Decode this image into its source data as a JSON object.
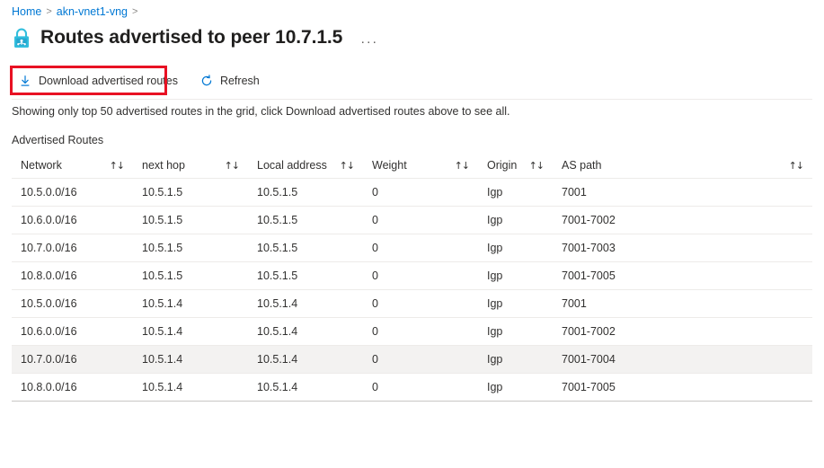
{
  "breadcrumb": {
    "items": [
      {
        "label": "Home"
      },
      {
        "label": "akn-vnet1-vng"
      }
    ],
    "separator": ">"
  },
  "header": {
    "icon": "vpn-gateway-lock-icon",
    "title": "Routes advertised to peer 10.7.1.5",
    "more_options": "···"
  },
  "command_bar": {
    "buttons": [
      {
        "label": "Download advertised routes",
        "icon": "download-icon",
        "highlighted": true
      },
      {
        "label": "Refresh",
        "icon": "refresh-icon",
        "highlighted": false
      }
    ]
  },
  "annotation": {
    "color": "#e81123",
    "target": "Download advertised routes"
  },
  "info_text": "Showing only top 50 advertised routes in the grid, click Download advertised routes above to see all.",
  "section_label": "Advertised Routes",
  "table": {
    "sort_glyph": "↑↓",
    "columns": [
      {
        "key": "network",
        "label": "Network"
      },
      {
        "key": "next_hop",
        "label": "next hop"
      },
      {
        "key": "local_address",
        "label": "Local address"
      },
      {
        "key": "weight",
        "label": "Weight"
      },
      {
        "key": "origin",
        "label": "Origin"
      },
      {
        "key": "as_path",
        "label": "AS path"
      },
      {
        "key": "spacer",
        "label": ""
      }
    ],
    "rows": [
      {
        "network": "10.5.0.0/16",
        "next_hop": "10.5.1.5",
        "local_address": "10.5.1.5",
        "weight": "0",
        "origin": "Igp",
        "as_path": "7001",
        "spacer": "",
        "hover": false
      },
      {
        "network": "10.6.0.0/16",
        "next_hop": "10.5.1.5",
        "local_address": "10.5.1.5",
        "weight": "0",
        "origin": "Igp",
        "as_path": "7001-7002",
        "spacer": "",
        "hover": false
      },
      {
        "network": "10.7.0.0/16",
        "next_hop": "10.5.1.5",
        "local_address": "10.5.1.5",
        "weight": "0",
        "origin": "Igp",
        "as_path": "7001-7003",
        "spacer": "",
        "hover": false
      },
      {
        "network": "10.8.0.0/16",
        "next_hop": "10.5.1.5",
        "local_address": "10.5.1.5",
        "weight": "0",
        "origin": "Igp",
        "as_path": "7001-7005",
        "spacer": "",
        "hover": false
      },
      {
        "network": "10.5.0.0/16",
        "next_hop": "10.5.1.4",
        "local_address": "10.5.1.4",
        "weight": "0",
        "origin": "Igp",
        "as_path": "7001",
        "spacer": "",
        "hover": false
      },
      {
        "network": "10.6.0.0/16",
        "next_hop": "10.5.1.4",
        "local_address": "10.5.1.4",
        "weight": "0",
        "origin": "Igp",
        "as_path": "7001-7002",
        "spacer": "",
        "hover": false
      },
      {
        "network": "10.7.0.0/16",
        "next_hop": "10.5.1.4",
        "local_address": "10.5.1.4",
        "weight": "0",
        "origin": "Igp",
        "as_path": "7001-7004",
        "spacer": "",
        "hover": true
      },
      {
        "network": "10.8.0.0/16",
        "next_hop": "10.5.1.4",
        "local_address": "10.5.1.4",
        "weight": "0",
        "origin": "Igp",
        "as_path": "7001-7005",
        "spacer": "",
        "hover": false
      }
    ]
  },
  "colors": {
    "link": "#0078d4",
    "accent": "#0078d4",
    "annotation": "#e81123",
    "row_hover": "#f3f2f1",
    "border": "#edebe9"
  }
}
